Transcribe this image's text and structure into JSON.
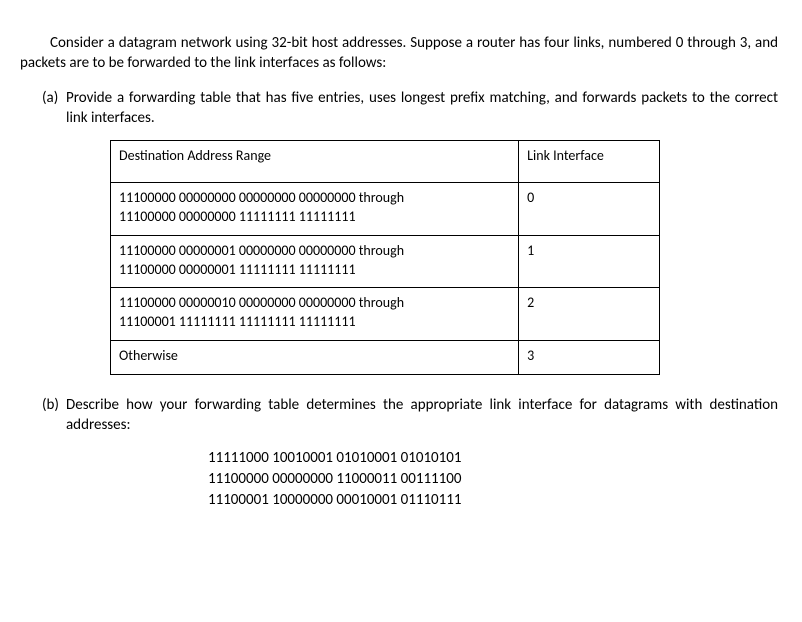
{
  "intro": "Consider a datagram network using 32-bit host addresses. Suppose a router has four links, numbered 0 through 3, and packets are to be forwarded to the link interfaces as follows:",
  "part_a": {
    "label": "(a)",
    "text": "Provide a forwarding table that has five entries, uses longest prefix matching, and forwards packets to the correct link interfaces."
  },
  "table": {
    "headers": {
      "dest": "Destination Address Range",
      "link": "Link Interface"
    },
    "rows": [
      {
        "dest_from": "11100000 00000000 00000000 00000000 through",
        "dest_to": "11100000 00000000 11111111 11111111",
        "link": "0"
      },
      {
        "dest_from": "11100000 00000001 00000000 00000000 through",
        "dest_to": "11100000 00000001 11111111 11111111",
        "link": "1"
      },
      {
        "dest_from": "11100000 00000010 00000000 00000000 through",
        "dest_to": "11100001 11111111 11111111 11111111",
        "link": "2"
      },
      {
        "dest_from": "Otherwise",
        "dest_to": "",
        "link": "3"
      }
    ]
  },
  "part_b": {
    "label": "(b)",
    "text": "Describe how your forwarding table determines the appropriate link interface for datagrams with destination addresses:"
  },
  "addresses": [
    "11111000 10010001 01010001 01010101",
    "11100000 00000000 11000011 00111100",
    "11100001 10000000 00010001 01110111"
  ]
}
